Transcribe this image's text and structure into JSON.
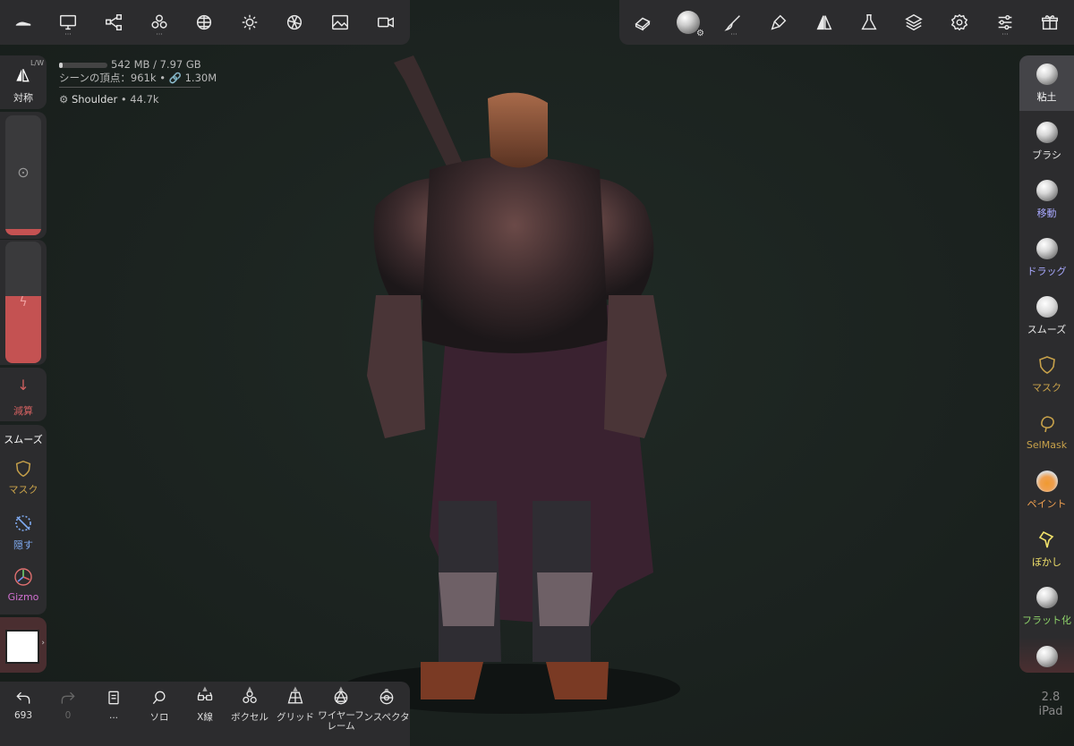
{
  "stats": {
    "memory": "542 MB / 7.97 GB",
    "memory_fraction": 0.068,
    "vertices_line": "シーンの頂点：961k • 🔗 1.30M",
    "object_name": "Shoulder",
    "object_vertices": "• 44.7k"
  },
  "top_left_toolbar": [
    {
      "icon": "shoe-icon"
    },
    {
      "icon": "monitor-icon"
    },
    {
      "icon": "nodes-icon"
    },
    {
      "icon": "voxel-icon"
    },
    {
      "icon": "sphere-grid-icon"
    },
    {
      "icon": "sun-icon"
    },
    {
      "icon": "aperture-icon"
    },
    {
      "icon": "image-icon"
    },
    {
      "icon": "video-icon"
    }
  ],
  "top_right_toolbar": [
    {
      "icon": "eraser-icon"
    },
    {
      "icon": "material-sphere-icon"
    },
    {
      "icon": "brush-icon"
    },
    {
      "icon": "paint-brush-icon"
    },
    {
      "icon": "symmetry-icon"
    },
    {
      "icon": "flask-icon"
    },
    {
      "icon": "layers-icon"
    },
    {
      "icon": "settings-icon"
    },
    {
      "icon": "sliders-icon"
    },
    {
      "icon": "gift-icon"
    }
  ],
  "left_panel": {
    "symmetry_label": "対称",
    "symmetry_badge": "L/W",
    "radius_fraction": 0.05,
    "intensity_fraction": 0.55,
    "subtract_label": "減算",
    "smooth_label": "スムーズ",
    "mask_label": "マスク",
    "hide_label": "隠す",
    "gizmo_label": "Gizmo",
    "color_swatch": "#ffffff",
    "accent_color": "#c45252"
  },
  "right_panel": {
    "tools": [
      {
        "label": "粘土",
        "color": "#ffffff"
      },
      {
        "label": "ブラシ",
        "color": "#e8e8e8"
      },
      {
        "label": "移動",
        "color": "#a9a9ff"
      },
      {
        "label": "ドラッグ",
        "color": "#a9a9ff"
      },
      {
        "label": "スムーズ",
        "color": "#e8e8e8"
      },
      {
        "label": "マスク",
        "color": "#c7a14a"
      },
      {
        "label": "SelMask",
        "color": "#c7a14a"
      },
      {
        "label": "ペイント",
        "color": "#f0a050"
      },
      {
        "label": "ぼかし",
        "color": "#f0e06a"
      },
      {
        "label": "フラット化",
        "color": "#8fd46a"
      }
    ],
    "version": "2.8",
    "platform": "iPad"
  },
  "bottom_toolbar": {
    "undo_count": "693",
    "redo_count": "0",
    "items": [
      {
        "label": "...",
        "icon": "book-icon"
      },
      {
        "label": "ソロ",
        "icon": "search-icon"
      },
      {
        "label": "X線",
        "icon": "glasses-icon"
      },
      {
        "label": "ボクセル",
        "icon": "voxel-icon"
      },
      {
        "label": "グリッド",
        "icon": "grid-icon"
      },
      {
        "label": "ワイヤーフレーム",
        "icon": "wireframe-icon"
      },
      {
        "label": "インスペクター",
        "icon": "eye-icon"
      }
    ]
  }
}
